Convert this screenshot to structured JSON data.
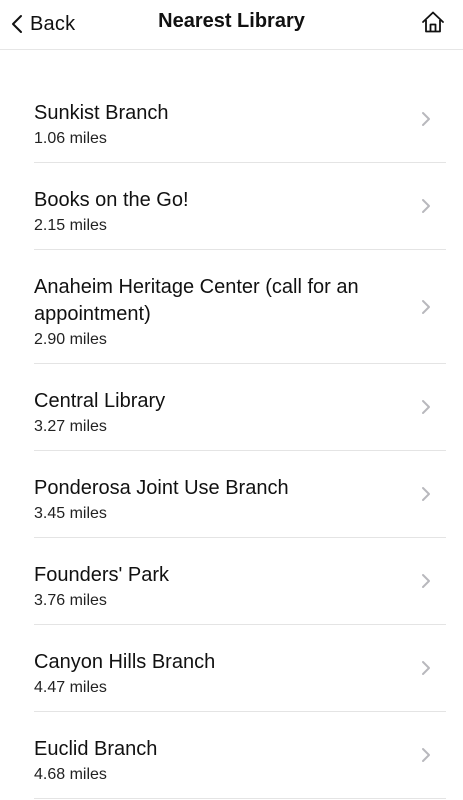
{
  "header": {
    "back_label": "Back",
    "title": "Nearest Library",
    "back_icon": "chevron-left-icon",
    "home_icon": "home-icon"
  },
  "libraries": [
    {
      "name": "Sunkist Branch",
      "distance": "1.06 miles"
    },
    {
      "name": "Books on the Go!",
      "distance": "2.15 miles"
    },
    {
      "name": "Anaheim Heritage Center (call for an appointment)",
      "distance": "2.90 miles"
    },
    {
      "name": "Central Library",
      "distance": "3.27 miles"
    },
    {
      "name": "Ponderosa Joint Use Branch",
      "distance": "3.45 miles"
    },
    {
      "name": "Founders' Park",
      "distance": "3.76 miles"
    },
    {
      "name": "Canyon Hills Branch",
      "distance": "4.47 miles"
    },
    {
      "name": "Euclid Branch",
      "distance": "4.68 miles"
    }
  ],
  "colors": {
    "text": "#111111",
    "separator": "#e4e4e4",
    "chevron": "#b8b8bd"
  }
}
